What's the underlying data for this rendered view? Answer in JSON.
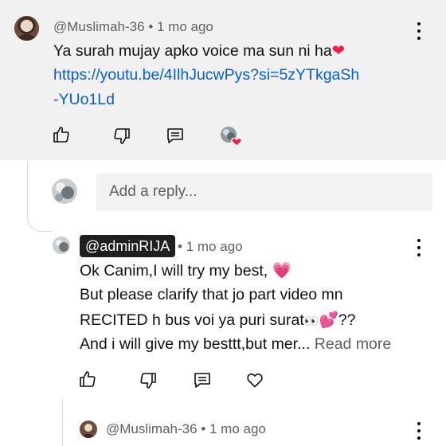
{
  "comment": {
    "author": "@Muslimah-36",
    "time": "1 mo ago",
    "line1": "Ya surah mujay apko voice ma sun ni ha",
    "link_line1": "https://youtu.be/4IlhJucwPys?si=5zYTkgaSh",
    "link_line2": "-YUo1Ld",
    "actions": [
      "like-icon",
      "dislike-icon",
      "reply-icon",
      "creator-heart-icon"
    ]
  },
  "reply_input": {
    "placeholder": "Add a reply..."
  },
  "reply": {
    "author": "@adminRIJA",
    "time": "1 mo ago",
    "line1": "Ok Canim,I will try my best,",
    "line2": "But please clarify that jo part video mn",
    "line3": "RECITED h bus voi ya puri surat",
    "line3_suffix": "??",
    "line4": "And i will give my besttt,but mer...",
    "read_more": "Read more",
    "actions": [
      "like-icon",
      "dislike-icon",
      "reply-icon",
      "heart-icon"
    ]
  },
  "next_reply": {
    "author": "@Muslimah-36",
    "time": "1 mo ago"
  },
  "dot": "•",
  "colors": {
    "top_card_bg": "#f1f1f1",
    "link": "#065fd4",
    "heart": "#ff1744",
    "pink_heart": "#ff4fa3",
    "chip_bg": "#1f1f1f"
  }
}
